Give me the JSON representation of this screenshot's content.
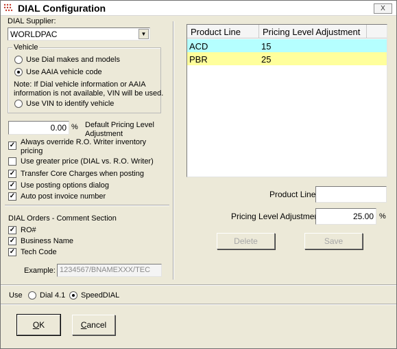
{
  "window": {
    "title": "DIAL Configuration",
    "close_label": "X"
  },
  "supplier": {
    "label": "DIAL Supplier:",
    "value": "WORLDPAC"
  },
  "vehicle": {
    "group_title": "Vehicle",
    "option_dial": "Use Dial makes and models",
    "option_aaia": "Use AAIA vehicle code",
    "note_line1": "Note: If Dial vehicle information or AAIA",
    "note_line2": "information is not available, VIN will be used.",
    "option_vin": "Use VIN to identify vehicle",
    "selected": "aaia"
  },
  "pricing": {
    "default_value": "0.00",
    "percent": "%",
    "default_label_line1": "Default Pricing Level",
    "default_label_line2": "Adjustment"
  },
  "options": {
    "override_line1": "Always override R.O. Writer inventory",
    "override_line2": "pricing",
    "greater_price": "Use greater price (DIAL vs. R.O. Writer)",
    "transfer_core": "Transfer Core Charges when posting",
    "posting_options": "Use posting options dialog",
    "auto_post": "Auto post invoice number"
  },
  "comment_section": {
    "title": "DIAL Orders - Comment Section",
    "ro": "RO#",
    "business_name": "Business Name",
    "tech_code": "Tech Code",
    "example_label": "Example:",
    "example_value": "1234567/BNAMEXXX/TEC"
  },
  "use_row": {
    "label": "Use",
    "dial41": "Dial 4.1",
    "speeddial": "SpeedDIAL",
    "selected": "speeddial"
  },
  "table": {
    "columns": [
      "Product Line",
      "Pricing Level Adjustment"
    ],
    "rows": [
      {
        "product_line": "ACD",
        "adjustment": "15",
        "color": "#b5ffff"
      },
      {
        "product_line": "PBR",
        "adjustment": "25",
        "color": "#ffff9c"
      }
    ]
  },
  "editor": {
    "product_line_label": "Product Line",
    "product_line_value": "",
    "adjustment_label": "Pricing Level Adjustment",
    "adjustment_value": "25.00",
    "percent": "%",
    "delete_label": "Delete",
    "save_label": "Save"
  },
  "footer": {
    "ok_label": "OK",
    "cancel_label": "Cancel"
  }
}
